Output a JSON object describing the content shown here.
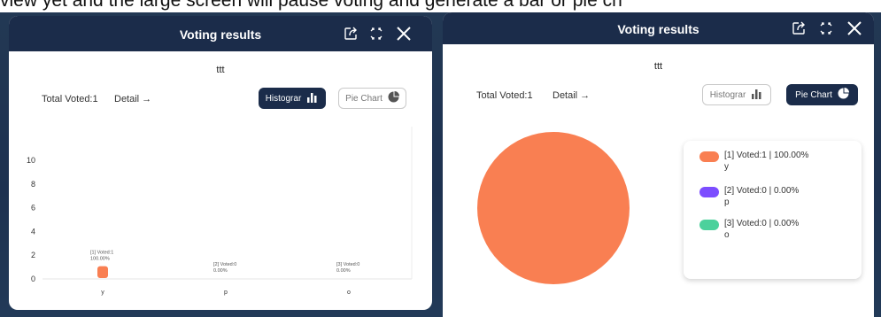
{
  "caption_fragment": "view yet and the large screen will pause voting and generate a bar or pie ch",
  "left_panel": {
    "title": "Voting results",
    "question": "ttt",
    "total": "Total Voted:1",
    "detail": "Detail →",
    "histogram_label": "Histograr",
    "pie_label": "Pie Chart",
    "active_view": "histogram"
  },
  "right_panel": {
    "title": "Voting results",
    "question": "ttt",
    "total": "Total Voted:1",
    "detail": "Detail →",
    "histogram_label": "Histograr",
    "pie_label": "Pie Chart",
    "active_view": "pie",
    "legend": [
      {
        "line1": "[1] Voted:1 | 100.00%",
        "line2": "y",
        "color": "#f97f52"
      },
      {
        "line1": "[2] Voted:0 | 0.00%",
        "line2": "p",
        "color": "#7c4dff"
      },
      {
        "line1": "[3] Voted:0 | 0.00%",
        "line2": "o",
        "color": "#4cd19c"
      }
    ]
  },
  "colors": {
    "header_bg": "#1b2c4a",
    "option_y": "#f97f52",
    "option_p": "#7c4dff",
    "option_o": "#4cd19c"
  },
  "chart_data": [
    {
      "type": "bar",
      "categories": [
        "y",
        "p",
        "o"
      ],
      "values": [
        1,
        0,
        0
      ],
      "data_labels": [
        {
          "line1": "[1] Voted:1",
          "line2": "100.00%"
        },
        {
          "line1": "[2] Voted:0",
          "line2": "0.00%"
        },
        {
          "line1": "[3] Voted:0",
          "line2": "0.00%"
        }
      ],
      "yticks": [
        0,
        2,
        4,
        6,
        8,
        10
      ],
      "ylim": [
        0,
        10
      ],
      "grid": false,
      "color": "#f97f52"
    },
    {
      "type": "pie",
      "categories": [
        "y",
        "p",
        "o"
      ],
      "values": [
        1,
        0,
        0
      ],
      "colors": [
        "#f97f52",
        "#7c4dff",
        "#4cd19c"
      ],
      "legend_position": "right"
    }
  ]
}
